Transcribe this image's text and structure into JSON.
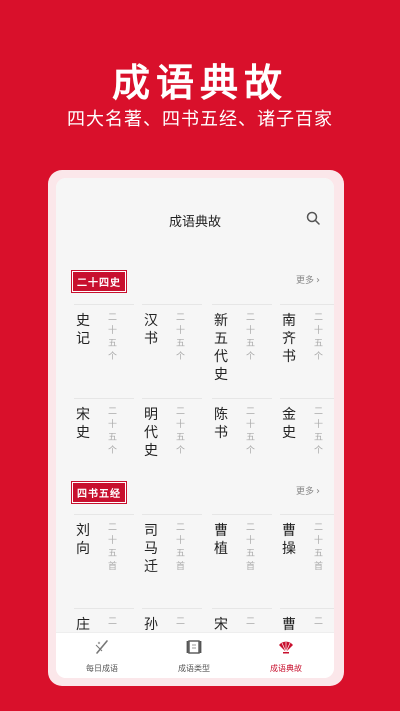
{
  "promo": {
    "title": "成语典故",
    "subtitle": "四大名著、四书五经、诸子百家"
  },
  "app": {
    "title": "成语典故"
  },
  "sections": [
    {
      "label": "二十四史",
      "more": "更多",
      "items": [
        {
          "name": "史记",
          "count": "二十五个"
        },
        {
          "name": "汉书",
          "count": "二十五个"
        },
        {
          "name": "新五代史",
          "count": "二十五个"
        },
        {
          "name": "南齐书",
          "count": "二十五个"
        },
        {
          "name": "宋史",
          "count": "二十五个"
        },
        {
          "name": "明代史",
          "count": "二十五个"
        },
        {
          "name": "陈书",
          "count": "二十五个"
        },
        {
          "name": "金史",
          "count": "二十五个"
        }
      ]
    },
    {
      "label": "四书五经",
      "more": "更多",
      "items": [
        {
          "name": "刘向",
          "count": "二十五首"
        },
        {
          "name": "司马迁",
          "count": "二十五首"
        },
        {
          "name": "曹植",
          "count": "二十五首"
        },
        {
          "name": "曹操",
          "count": "二十五首"
        },
        {
          "name": "庄",
          "count": "二"
        },
        {
          "name": "孙",
          "count": "二"
        },
        {
          "name": "宋",
          "count": "二"
        },
        {
          "name": "曹",
          "count": "二"
        }
      ]
    }
  ],
  "tabs": [
    {
      "label": "每日成语",
      "icon": "brush-icon",
      "active": false
    },
    {
      "label": "成语类型",
      "icon": "scroll-icon",
      "active": false
    },
    {
      "label": "成语典故",
      "icon": "fan-icon",
      "active": true
    }
  ],
  "colors": {
    "background": "#d9102b",
    "accent": "#c8102e"
  }
}
